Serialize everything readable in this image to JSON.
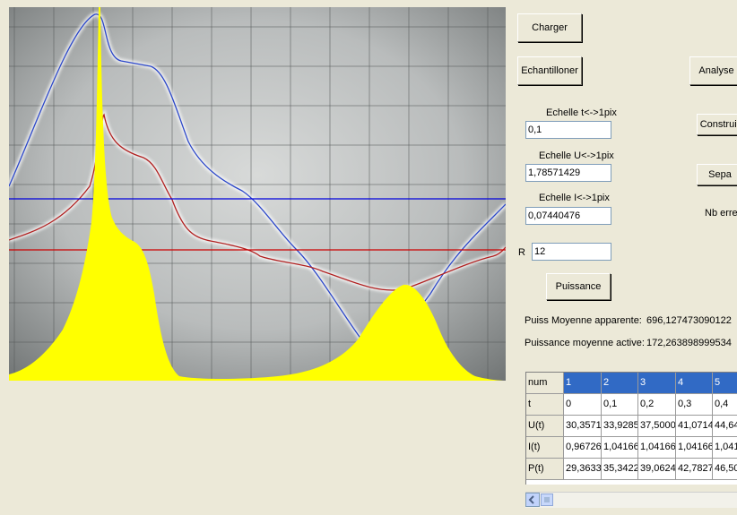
{
  "buttons": {
    "charger": "Charger",
    "echantillonner": "Echantilloner",
    "analyser": "Analyse",
    "construire": "Construir",
    "separer": "Sepa",
    "puissance": "Puissance"
  },
  "fields": {
    "echelle_t": {
      "label": "Echelle t<->1pix",
      "value": "0,1"
    },
    "echelle_u": {
      "label": "Echelle U<->1pix",
      "value": "1,78571429"
    },
    "echelle_i": {
      "label": "Echelle I<->1pix",
      "value": "0,07440476"
    },
    "r": {
      "label": "R",
      "value": "12"
    }
  },
  "nb_erreurs_label": "Nb errer",
  "results": {
    "apparent_label": "Puiss Moyenne apparente:",
    "apparent_value": "696,127473090122",
    "active_label": "Puissance moyenne active:",
    "active_value": "172,263898999534"
  },
  "table": {
    "rows": [
      {
        "head": "num",
        "cells": [
          "1",
          "2",
          "3",
          "4",
          "5"
        ]
      },
      {
        "head": "t",
        "cells": [
          "0",
          "0,1",
          "0,2",
          "0,3",
          "0,4"
        ]
      },
      {
        "head": "U(t)",
        "cells": [
          "30,3571",
          "33,9285",
          "37,5000",
          "41,0714",
          "44,64"
        ]
      },
      {
        "head": "I(t)",
        "cells": [
          "0,96726",
          "1,04166",
          "1,04166",
          "1,04166",
          "1,041"
        ]
      },
      {
        "head": "P(t)",
        "cells": [
          "29,3633",
          "35,3422",
          "39,0624",
          "42,7827",
          "46,50"
        ]
      }
    ]
  },
  "colors": {
    "power_fill": "#ffff00",
    "voltage_trace": "#2a46c8",
    "current_trace": "#b02020",
    "voltage_mean_line": "#0000dd",
    "current_mean_line": "#cc0000",
    "selection": "#316ac5"
  }
}
